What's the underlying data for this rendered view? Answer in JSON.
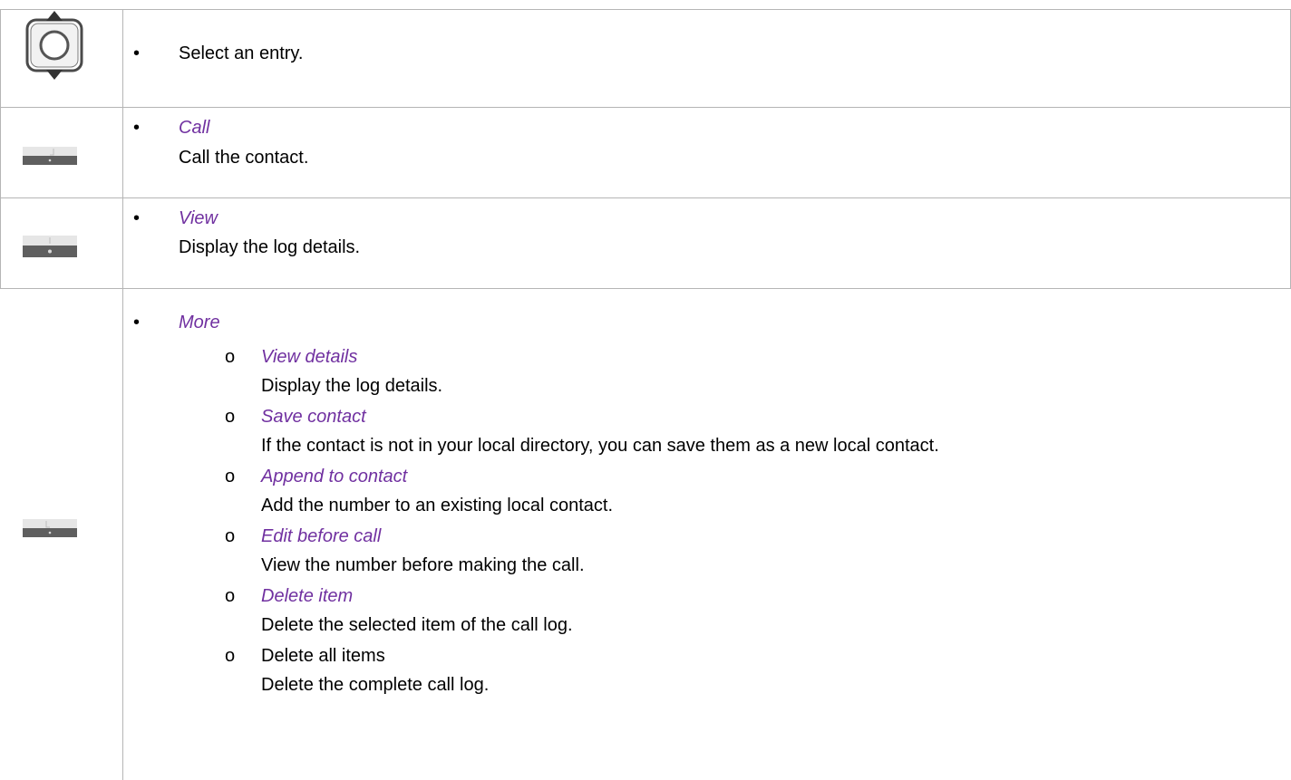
{
  "rows": [
    {
      "icon": "navigation-key-icon",
      "items": [
        {
          "text": "Select an entry."
        }
      ]
    },
    {
      "icon": "softkey-left-icon",
      "items": [
        {
          "label": "Call",
          "desc": "Call the contact."
        }
      ]
    },
    {
      "icon": "softkey-middle-icon",
      "items": [
        {
          "label": "View",
          "desc": "Display the log details."
        }
      ]
    },
    {
      "icon": "softkey-right-icon",
      "items": [
        {
          "label": "More",
          "subitems": [
            {
              "label": "View details",
              "desc": "Display the log details."
            },
            {
              "label": "Save contact",
              "desc": "If the contact is not in your local directory, you can save them as a new local contact."
            },
            {
              "label": "Append to contact",
              "desc": "Add the number to an existing local contact."
            },
            {
              "label": "Edit before call",
              "desc": "View the number before making the call."
            },
            {
              "label": "Delete item",
              "desc": "Delete the selected item of the call log."
            },
            {
              "label": "Delete all items",
              "desc": "Delete the complete call log."
            }
          ]
        }
      ]
    }
  ],
  "bullet_char": "•",
  "sub_bullet_char": "o",
  "colors": {
    "accent_italic": "#7030a0",
    "grid": "#b5b5b5"
  }
}
